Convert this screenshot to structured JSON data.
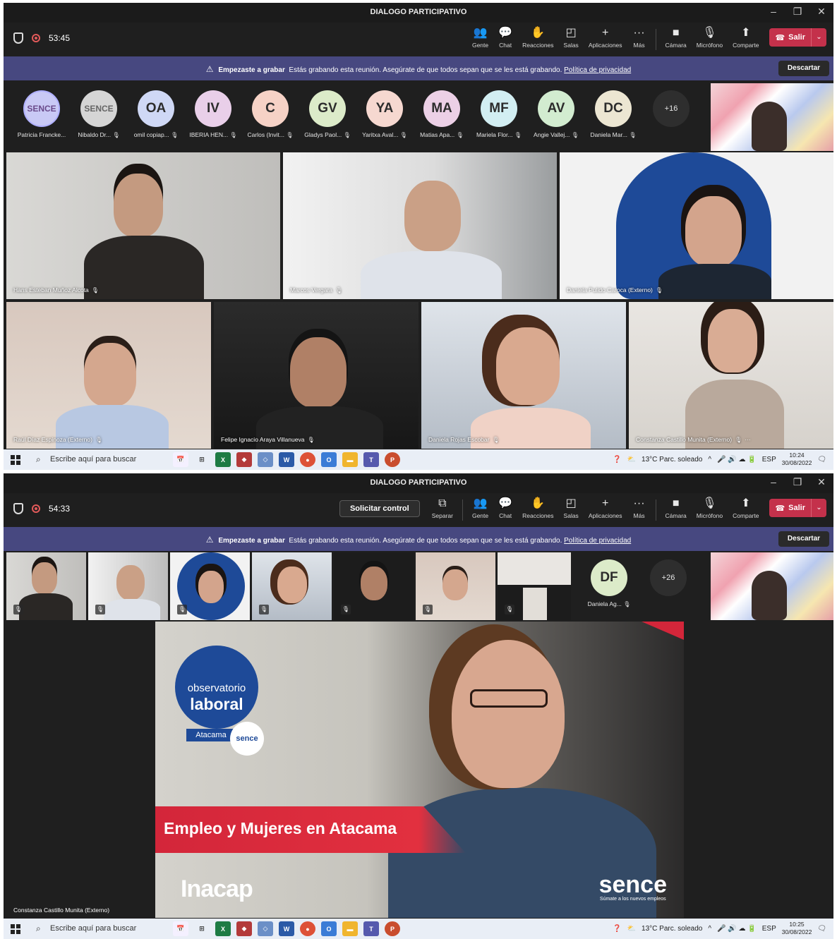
{
  "shot1": {
    "window_title": "DIALOGO PARTICIPATIVO",
    "timer": "53:45",
    "toolbar": [
      {
        "icon": "people-icon",
        "label": "Gente"
      },
      {
        "icon": "chat-icon",
        "label": "Chat"
      },
      {
        "icon": "reactions-icon",
        "label": "Reacciones"
      },
      {
        "icon": "rooms-icon",
        "label": "Salas"
      },
      {
        "icon": "plus-icon",
        "label": "Aplicaciones"
      },
      {
        "icon": "more-icon",
        "label": "Más"
      },
      {
        "icon": "camera-icon",
        "label": "Cámara"
      },
      {
        "icon": "mic-off-icon",
        "label": "Micrófono"
      },
      {
        "icon": "share-icon",
        "label": "Comparte"
      }
    ],
    "leave_label": "Salir",
    "banner": {
      "bold": "Empezaste a grabar",
      "text": "Estás grabando esta reunión. Asegúrate de que todos sepan que se les está grabando.",
      "link": "Política de privacidad",
      "dismiss": "Descartar"
    },
    "participants": [
      {
        "initials": "",
        "name": "Patricia Francke...",
        "color": "#c9c9f5"
      },
      {
        "initials": "",
        "name": "Nibaldo Dr...",
        "color": "#d5d5d5"
      },
      {
        "initials": "OA",
        "name": "omil copiap...",
        "color": "#cfd8f5"
      },
      {
        "initials": "IV",
        "name": "IBERIA HEN...",
        "color": "#e9cfe9"
      },
      {
        "initials": "C",
        "name": "Carlos (Invit...",
        "color": "#f6d2c6"
      },
      {
        "initials": "GV",
        "name": "Gladys Paol...",
        "color": "#dcebc9"
      },
      {
        "initials": "YA",
        "name": "Yaritxa Aval...",
        "color": "#f6d8d0"
      },
      {
        "initials": "MA",
        "name": "Matias Apa...",
        "color": "#ecd0e6"
      },
      {
        "initials": "MF",
        "name": "Mariela Flor...",
        "color": "#d2eef2"
      },
      {
        "initials": "AV",
        "name": "Angie Vallej...",
        "color": "#d2ecd0"
      },
      {
        "initials": "DC",
        "name": "Daniela Mar...",
        "color": "#ece6d2"
      }
    ],
    "more_count": "+16",
    "video_tiles": [
      {
        "name": "Hans Esteban Muñoz Alcota"
      },
      {
        "name": "Marcos Vergara"
      },
      {
        "name": "Daniela Pulido Caroca (Externo)"
      },
      {
        "name": "Raúl Díaz Espinoza (Externo)"
      },
      {
        "name": "Felipe Ignacio Araya Villanueva"
      },
      {
        "name": "Daniela Rojas Escobar"
      },
      {
        "name": "Constanza Castillo Munita (Externo)"
      }
    ],
    "tile_more": "···",
    "taskbar": {
      "search": "Escribe aquí para buscar",
      "weather": "13°C  Parc. soleado",
      "lang": "ESP",
      "time": "10:24",
      "date": "30/08/2022"
    }
  },
  "shot2": {
    "window_title": "DIALOGO PARTICIPATIVO",
    "timer": "54:33",
    "request_control": "Solicitar control",
    "toolbar": [
      {
        "icon": "popout-icon",
        "label": "Separar"
      },
      {
        "icon": "people-icon",
        "label": "Gente"
      },
      {
        "icon": "chat-icon",
        "label": "Chat"
      },
      {
        "icon": "reactions-icon",
        "label": "Reacciones"
      },
      {
        "icon": "rooms-icon",
        "label": "Salas"
      },
      {
        "icon": "plus-icon",
        "label": "Aplicaciones"
      },
      {
        "icon": "more-icon",
        "label": "Más"
      },
      {
        "icon": "camera-icon",
        "label": "Cámara"
      },
      {
        "icon": "mic-off-icon",
        "label": "Micrófono"
      },
      {
        "icon": "share-icon",
        "label": "Comparte"
      }
    ],
    "leave_label": "Salir",
    "banner": {
      "bold": "Empezaste a grabar",
      "text": "Estás grabando esta reunión. Asegúrate de que todos sepan que se les está grabando.",
      "link": "Política de privacidad",
      "dismiss": "Descartar"
    },
    "strip_avatar": {
      "initials": "DF",
      "name": "Daniela Ag..."
    },
    "more_count": "+26",
    "stage": {
      "badge_line1": "observatorio",
      "badge_line2": "laboral",
      "badge_region": "Atacama",
      "badge_sence": "sence",
      "headline": "Empleo y Mujeres en Atacama",
      "left_logo": "Inacap",
      "right_logo": "sence",
      "right_tagline": "Súmate a los nuevos empleos",
      "speaker_name": "Constanza Castillo Munita (Externo)"
    },
    "taskbar": {
      "search": "Escribe aquí para buscar",
      "weather": "13°C  Parc. soleado",
      "lang": "ESP",
      "time": "10:25",
      "date": "30/08/2022"
    }
  }
}
